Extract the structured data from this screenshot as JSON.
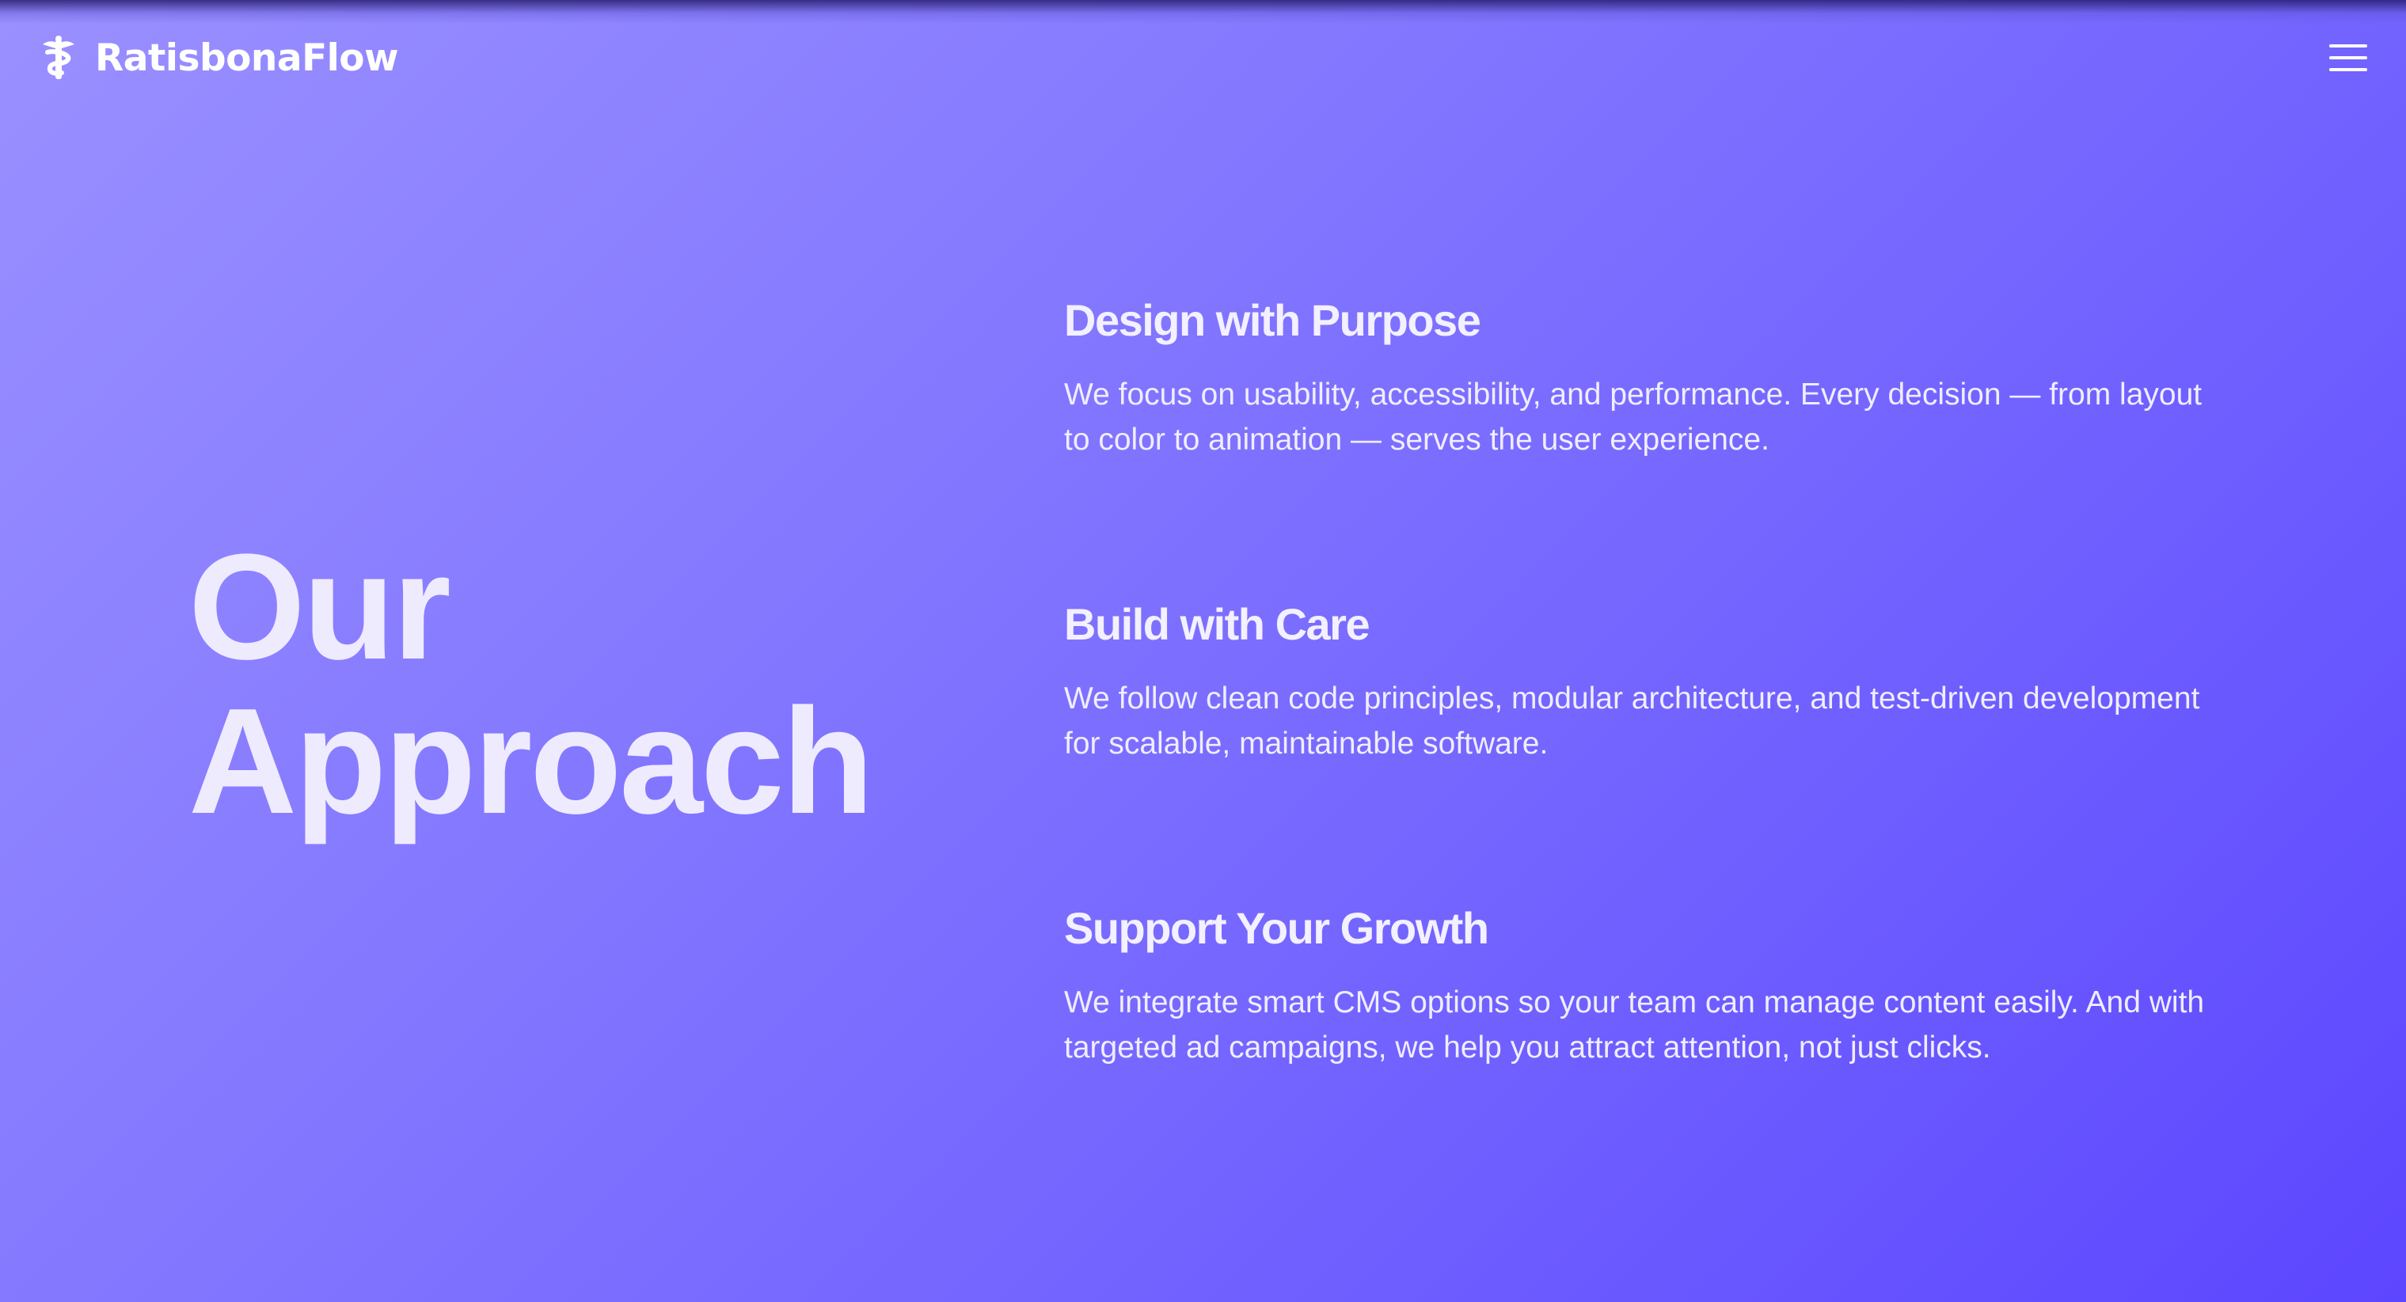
{
  "brand": {
    "name": "RatisbonaFlow",
    "icon": "caduceus-icon"
  },
  "header": {
    "menu_icon": "hamburger-menu-icon"
  },
  "hero": {
    "title_line1": "Our",
    "title_line2": "Approach"
  },
  "approach": [
    {
      "heading": "Design with Purpose",
      "text": "We focus on usability, accessibility, and performance. Every decision — from layout to color to animation — serves the user experience."
    },
    {
      "heading": "Build with Care",
      "text": "We follow clean code principles, modular architecture, and test-driven development for scalable, maintainable software."
    },
    {
      "heading": "Support Your Growth",
      "text": "We integrate smart CMS options so your team can manage content easily. And with targeted ad campaigns, we help you attract attention, not just clicks."
    }
  ],
  "colors": {
    "gradient_start": "#9A90FF",
    "gradient_end": "#5D46FF",
    "text": "#F1EEFF"
  }
}
